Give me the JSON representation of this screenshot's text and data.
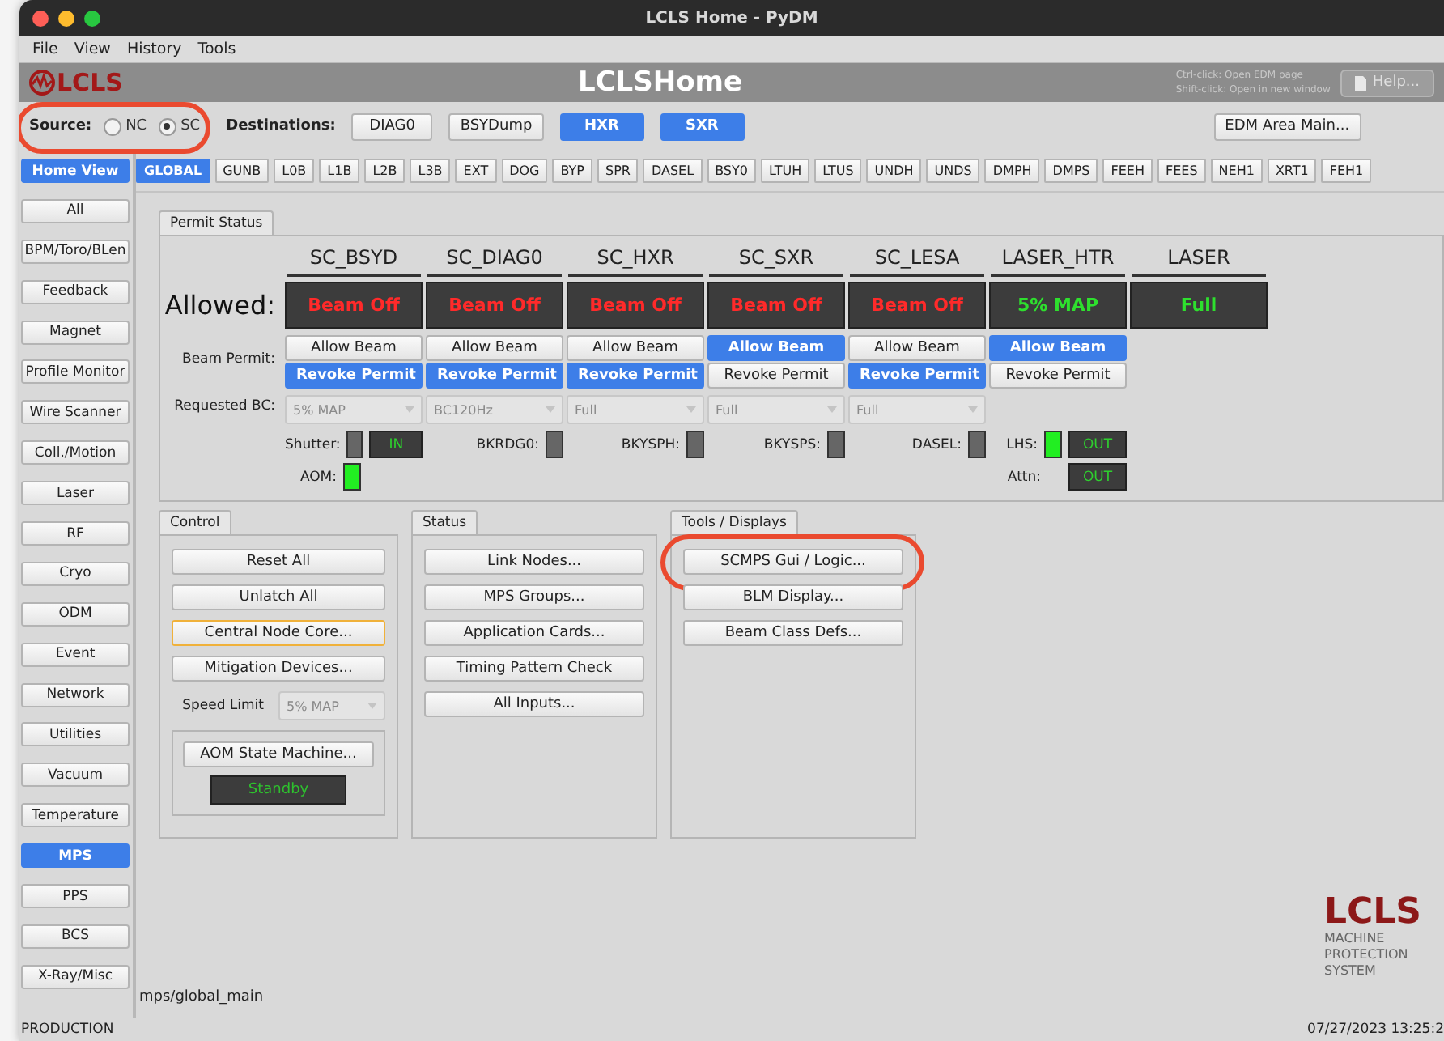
{
  "window": {
    "title": "LCLS Home - PyDM"
  },
  "menu": [
    "File",
    "View",
    "History",
    "Tools"
  ],
  "header": {
    "logo": "LCLS",
    "title": "LCLSHome",
    "hints": [
      "Ctrl-click: Open EDM page",
      "Shift-click: Open in new window"
    ],
    "help": "Help..."
  },
  "source": {
    "label": "Source:",
    "highlighted": true,
    "options": [
      {
        "label": "NC",
        "selected": false
      },
      {
        "label": "SC",
        "selected": true
      }
    ]
  },
  "destinations": {
    "label": "Destinations:",
    "items": [
      {
        "label": "DIAG0",
        "selected": false
      },
      {
        "label": "BSYDump",
        "selected": false
      },
      {
        "label": "HXR",
        "selected": true
      },
      {
        "label": "SXR",
        "selected": true
      }
    ]
  },
  "edm_button": "EDM Area Main...",
  "areas": [
    {
      "label": "GLOBAL",
      "selected": true
    },
    {
      "label": "GUNB",
      "selected": false
    },
    {
      "label": "L0B",
      "selected": false
    },
    {
      "label": "L1B",
      "selected": false
    },
    {
      "label": "L2B",
      "selected": false
    },
    {
      "label": "L3B",
      "selected": false
    },
    {
      "label": "EXT",
      "selected": false
    },
    {
      "label": "DOG",
      "selected": false
    },
    {
      "label": "BYP",
      "selected": false
    },
    {
      "label": "SPR",
      "selected": false
    },
    {
      "label": "DASEL",
      "selected": false
    },
    {
      "label": "BSY0",
      "selected": false
    },
    {
      "label": "LTUH",
      "selected": false
    },
    {
      "label": "LTUS",
      "selected": false
    },
    {
      "label": "UNDH",
      "selected": false
    },
    {
      "label": "UNDS",
      "selected": false
    },
    {
      "label": "DMPH",
      "selected": false
    },
    {
      "label": "DMPS",
      "selected": false
    },
    {
      "label": "FEEH",
      "selected": false
    },
    {
      "label": "FEES",
      "selected": false
    },
    {
      "label": "NEH1",
      "selected": false
    },
    {
      "label": "XRT1",
      "selected": false
    },
    {
      "label": "FEH1",
      "selected": false
    }
  ],
  "sidebar": [
    {
      "label": "Home View",
      "selected": true
    },
    {
      "label": "All",
      "selected": false
    },
    {
      "label": "BPM/Toro/BLen",
      "selected": false
    },
    {
      "label": "Feedback",
      "selected": false
    },
    {
      "label": "Magnet",
      "selected": false
    },
    {
      "label": "Profile Monitor",
      "selected": false
    },
    {
      "label": "Wire Scanner",
      "selected": false
    },
    {
      "label": "Coll./Motion",
      "selected": false
    },
    {
      "label": "Laser",
      "selected": false
    },
    {
      "label": "RF",
      "selected": false
    },
    {
      "label": "Cryo",
      "selected": false
    },
    {
      "label": "ODM",
      "selected": false
    },
    {
      "label": "Event",
      "selected": false
    },
    {
      "label": "Network",
      "selected": false
    },
    {
      "label": "Utilities",
      "selected": false
    },
    {
      "label": "Vacuum",
      "selected": false
    },
    {
      "label": "Temperature",
      "selected": false
    },
    {
      "label": "MPS",
      "selected": true
    },
    {
      "label": "PPS",
      "selected": false
    },
    {
      "label": "BCS",
      "selected": false
    },
    {
      "label": "X-Ray/Misc",
      "selected": false
    }
  ],
  "permit": {
    "tab": "Permit Status",
    "row_labels": {
      "allowed": "Allowed:",
      "beam_permit": "Beam Permit:",
      "requested_bc": "Requested BC:"
    },
    "columns": [
      {
        "name": "SC_BSYD",
        "state": "Beam Off",
        "allowed": false,
        "buttons": [
          {
            "label": "Allow Beam",
            "selected": false
          },
          {
            "label": "Revoke Permit",
            "selected": true
          }
        ],
        "requested_bc": "5% MAP",
        "signals": [
          {
            "label": "Shutter:",
            "led": false,
            "readout": "IN"
          },
          {
            "label": "AOM:",
            "led": true
          }
        ]
      },
      {
        "name": "SC_DIAG0",
        "state": "Beam Off",
        "allowed": false,
        "buttons": [
          {
            "label": "Allow Beam",
            "selected": false
          },
          {
            "label": "Revoke Permit",
            "selected": true
          }
        ],
        "requested_bc": "BC120Hz",
        "signals": [
          {
            "label": "BKRDG0:",
            "led": false
          }
        ]
      },
      {
        "name": "SC_HXR",
        "state": "Beam Off",
        "allowed": false,
        "buttons": [
          {
            "label": "Allow Beam",
            "selected": false
          },
          {
            "label": "Revoke Permit",
            "selected": true
          }
        ],
        "requested_bc": "Full",
        "signals": [
          {
            "label": "BKYSPH:",
            "led": false
          }
        ]
      },
      {
        "name": "SC_SXR",
        "state": "Beam Off",
        "allowed": false,
        "buttons": [
          {
            "label": "Allow Beam",
            "selected": true
          },
          {
            "label": "Revoke Permit",
            "selected": false
          }
        ],
        "requested_bc": "Full",
        "signals": [
          {
            "label": "BKYSPS:",
            "led": false
          }
        ]
      },
      {
        "name": "SC_LESA",
        "state": "Beam Off",
        "allowed": false,
        "buttons": [
          {
            "label": "Allow Beam",
            "selected": false
          },
          {
            "label": "Revoke Permit",
            "selected": true
          }
        ],
        "requested_bc": "Full",
        "signals": [
          {
            "label": "DASEL:",
            "led": false
          }
        ]
      },
      {
        "name": "LASER_HTR",
        "state": "5% MAP",
        "allowed": true,
        "buttons": [
          {
            "label": "Allow Beam",
            "selected": true
          },
          {
            "label": "Revoke Permit",
            "selected": false
          }
        ],
        "signals": [
          {
            "label": "LHS:",
            "led": true,
            "readout": "OUT"
          },
          {
            "label": "Attn:",
            "readout": "OUT"
          }
        ]
      },
      {
        "name": "LASER",
        "state": "Full",
        "allowed": true
      }
    ]
  },
  "control": {
    "tab": "Control",
    "buttons": [
      {
        "label": "Reset All",
        "focused": false
      },
      {
        "label": "Unlatch All",
        "focused": false
      },
      {
        "label": "Central Node Core...",
        "focused": true
      },
      {
        "label": "Mitigation Devices...",
        "focused": false
      }
    ],
    "speed_limit": {
      "label": "Speed Limit",
      "value": "5% MAP"
    },
    "aom": {
      "button": "AOM State Machine...",
      "readout": "Standby"
    }
  },
  "panels": [
    {
      "tab": "Status",
      "buttons": [
        {
          "label": "Link Nodes...",
          "highlighted": false
        },
        {
          "label": "MPS Groups...",
          "highlighted": false
        },
        {
          "label": "Application Cards...",
          "highlighted": false
        },
        {
          "label": "Timing Pattern Check",
          "highlighted": false
        },
        {
          "label": "All Inputs...",
          "highlighted": false
        }
      ]
    },
    {
      "tab": "Tools / Displays",
      "buttons": [
        {
          "label": "SCMPS Gui / Logic...",
          "highlighted": true
        },
        {
          "label": "BLM Display...",
          "highlighted": false
        },
        {
          "label": "Beam Class Defs...",
          "highlighted": false
        }
      ]
    }
  ],
  "mps_logo": {
    "title": "LCLS",
    "subtitle": "MACHINE PROTECTION SYSTEM"
  },
  "path": "mps/global_main",
  "status_bar": {
    "mode": "PRODUCTION",
    "timestamp": "07/27/2023 13:25:2"
  }
}
